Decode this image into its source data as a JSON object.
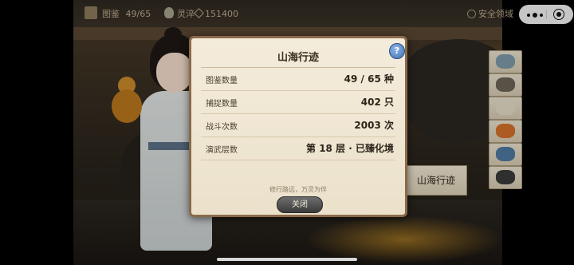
{
  "topbar": {
    "catalog_label": "图鉴",
    "catalog_count": "49/65",
    "spirit_label": "灵淬",
    "spirit_amount": "151400",
    "zone_label": "安全领域"
  },
  "scene_button_label": "山海行迹",
  "modal": {
    "title": "山海行迹",
    "help_label": "?",
    "stats": [
      {
        "label": "图鉴数量",
        "value": "49 / 65 种"
      },
      {
        "label": "捕捉数量",
        "value": "402 只"
      },
      {
        "label": "战斗次数",
        "value": "2003 次"
      },
      {
        "label": "演武层数",
        "value": "第 18 层 · 已臻化境"
      }
    ],
    "motto": "修行路远，万灵为伴",
    "close_label": "关闭"
  },
  "colors": {
    "modal_bg": "#f4ecdb",
    "modal_border": "#8a6a4a",
    "help_blue": "#3f6fb2",
    "close_btn": "#4a4a4a"
  }
}
